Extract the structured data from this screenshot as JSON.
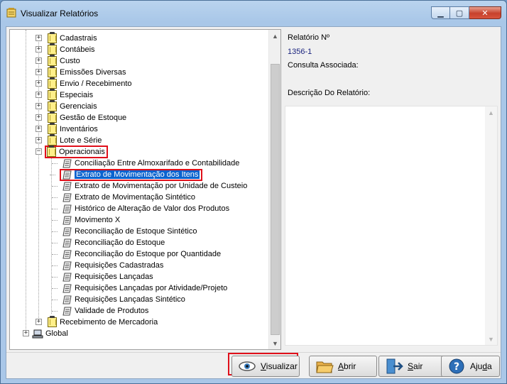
{
  "window": {
    "title": "Visualizar Relatórios",
    "buttons": {
      "minimize": "▁",
      "maximize": "▢",
      "close": "✕"
    }
  },
  "tree": {
    "folders_top": [
      {
        "label": "Cadastrais"
      },
      {
        "label": "Contábeis"
      },
      {
        "label": "Custo"
      },
      {
        "label": "Emissões Diversas"
      },
      {
        "label": "Envio / Recebimento"
      },
      {
        "label": "Especiais"
      },
      {
        "label": "Gerenciais"
      },
      {
        "label": "Gestão de Estoque"
      },
      {
        "label": "Inventários"
      },
      {
        "label": "Lote e Série"
      }
    ],
    "expanded_folder": {
      "label": "Operacionais"
    },
    "reports": [
      {
        "label": "Conciliação Entre Almoxarifado e Contabilidade"
      },
      {
        "label": "Extrato de Movimentação dos Itens",
        "selected": true
      },
      {
        "label": "Extrato de Movimentação por Unidade de Custeio"
      },
      {
        "label": "Extrato de Movimentação Sintético"
      },
      {
        "label": "Histórico de Alteração de Valor dos Produtos"
      },
      {
        "label": "Movimento X"
      },
      {
        "label": "Reconciliação de Estoque Sintético"
      },
      {
        "label": "Reconciliação do Estoque"
      },
      {
        "label": "Reconciliação do Estoque por Quantidade"
      },
      {
        "label": "Requisições Cadastradas"
      },
      {
        "label": "Requisições Lançadas"
      },
      {
        "label": "Requisições Lançadas por Atividade/Projeto"
      },
      {
        "label": "Requisições Lançadas Sintético"
      },
      {
        "label": "Validade de Produtos"
      }
    ],
    "folder_after": {
      "label": "Recebimento de Mercadoria"
    },
    "root_global": {
      "label": "Global"
    }
  },
  "details": {
    "report_number_label": "Relatório Nº",
    "report_number_value": "1356-1",
    "query_label": "Consulta Associada:",
    "description_label": "Descrição Do Relatório:"
  },
  "buttons": {
    "visualizar": "Visualizar",
    "abrir": "Abrir",
    "sair": "Sair",
    "ajuda": "Ajuda"
  },
  "colors": {
    "selection": "#0a63cf",
    "highlight_box": "#e0101b"
  }
}
